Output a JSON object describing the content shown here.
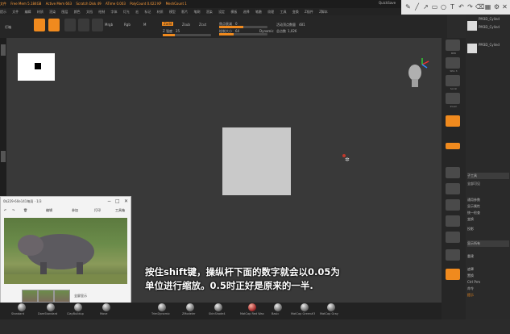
{
  "menubar": {
    "items": [
      "文件",
      "Free Mem 5.184GB",
      "Active Mem 663",
      "Scratch Disk 49",
      "ATime 0.003",
      "PolyCount 0.022 KP",
      "MeshCount 1"
    ],
    "menus": [
      "提示",
      "文件",
      "编辑",
      "材质",
      "渲染",
      "图层",
      "颜色",
      "文档",
      "绘制",
      "字体",
      "灯光",
      "宏",
      "标记",
      "材质",
      "模型",
      "影片",
      "笔刷",
      "渲染",
      "设定",
      "模板",
      "选择",
      "笔触",
      "纹理",
      "工具",
      "变换",
      "Z插件",
      "Z脚本"
    ],
    "quicksave": "QuickSave"
  },
  "shelf": {
    "label_light": "灯箱",
    "mrgb": "Mrgb",
    "rgb": "Rgb",
    "m": "M",
    "zadd": "Zadd",
    "zsub": "Zsub",
    "zcut": "Zcut",
    "z_intensity_label": "Z 强度",
    "z_intensity_value": "25",
    "focal_shift_label": "焦点衰减",
    "focal_shift_value": "0",
    "draw_size_label": "绘制大小",
    "draw_size_value": "64",
    "dynamic": "Dynamic",
    "active_points_label": "活动顶点数量",
    "active_points_value": "481",
    "total_points_label": "总点数",
    "total_points_value": "1,026"
  },
  "right_panel": {
    "rows": [
      "PM3D_Cylind",
      "PM3D_Cylind",
      "PM3D_Cylind",
      "",
      "子工具",
      "全部可见",
      "重置文件名",
      "",
      "通用参数",
      "显示属性",
      "统一检查",
      "",
      "变换",
      "全部",
      "投影",
      "",
      "显示所有",
      "",
      "重建",
      "",
      "遮罩",
      "置换",
      "Ctrl Prm",
      "",
      "命令",
      "提示",
      "",
      "发布",
      "",
      "3D材质",
      "",
      "",
      "",
      "",
      "",
      "",
      "",
      "",
      "",
      "自动折叠"
    ],
    "orange_rows": [
      4,
      30
    ]
  },
  "right_tools": [
    "BPR",
    "SPix 3",
    "Scroll",
    "Zoom",
    "Actual",
    "AAHalf",
    "Persp",
    "Floor",
    "Local",
    "Frame",
    "Move",
    "Scale",
    "Rotate",
    "Line Fill",
    "PolyF",
    "Transp",
    "Dynamic",
    "Solo",
    "Xpose"
  ],
  "popup": {
    "title": "0b229-60e141每局 · 1/3",
    "toolbar": [
      "编辑",
      "参加",
      "打印",
      "工具箱"
    ],
    "caption": "全屏显示"
  },
  "subtitle": {
    "line1": "按住shift键，操纵杆下面的数字就会以0.05为",
    "line2": "单位进行缩放。0.5时正好是原来的一半."
  },
  "materials": [
    {
      "label": "Standard",
      "red": false
    },
    {
      "label": "DamStandard",
      "red": false
    },
    {
      "label": "ClayBuildup",
      "red": false
    },
    {
      "label": "Move",
      "red": false
    },
    {
      "label": "TrimDynamic",
      "red": false
    },
    {
      "label": "ZModeler",
      "red": false
    },
    {
      "label": "SkinShade4",
      "red": false
    },
    {
      "label": "MatCap Red Wax",
      "red": true
    },
    {
      "label": "Basic",
      "red": false
    },
    {
      "label": "MatCap Green#3",
      "red": false
    },
    {
      "label": "MatCap Gray",
      "red": false
    }
  ],
  "colors": {
    "accent": "#f08a1e",
    "canvas": "#393939",
    "model": "#c9c9c9"
  }
}
